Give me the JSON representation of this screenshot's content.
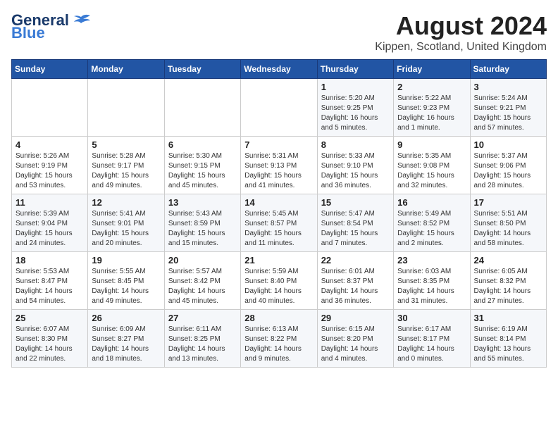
{
  "logo": {
    "general": "General",
    "blue": "Blue",
    "url_text": "GeneralBlue"
  },
  "title": "August 2024",
  "subtitle": "Kippen, Scotland, United Kingdom",
  "days_header": [
    "Sunday",
    "Monday",
    "Tuesday",
    "Wednesday",
    "Thursday",
    "Friday",
    "Saturday"
  ],
  "weeks": [
    [
      {
        "day": "",
        "content": ""
      },
      {
        "day": "",
        "content": ""
      },
      {
        "day": "",
        "content": ""
      },
      {
        "day": "",
        "content": ""
      },
      {
        "day": "1",
        "content": "Sunrise: 5:20 AM\nSunset: 9:25 PM\nDaylight: 16 hours\nand 5 minutes."
      },
      {
        "day": "2",
        "content": "Sunrise: 5:22 AM\nSunset: 9:23 PM\nDaylight: 16 hours\nand 1 minute."
      },
      {
        "day": "3",
        "content": "Sunrise: 5:24 AM\nSunset: 9:21 PM\nDaylight: 15 hours\nand 57 minutes."
      }
    ],
    [
      {
        "day": "4",
        "content": "Sunrise: 5:26 AM\nSunset: 9:19 PM\nDaylight: 15 hours\nand 53 minutes."
      },
      {
        "day": "5",
        "content": "Sunrise: 5:28 AM\nSunset: 9:17 PM\nDaylight: 15 hours\nand 49 minutes."
      },
      {
        "day": "6",
        "content": "Sunrise: 5:30 AM\nSunset: 9:15 PM\nDaylight: 15 hours\nand 45 minutes."
      },
      {
        "day": "7",
        "content": "Sunrise: 5:31 AM\nSunset: 9:13 PM\nDaylight: 15 hours\nand 41 minutes."
      },
      {
        "day": "8",
        "content": "Sunrise: 5:33 AM\nSunset: 9:10 PM\nDaylight: 15 hours\nand 36 minutes."
      },
      {
        "day": "9",
        "content": "Sunrise: 5:35 AM\nSunset: 9:08 PM\nDaylight: 15 hours\nand 32 minutes."
      },
      {
        "day": "10",
        "content": "Sunrise: 5:37 AM\nSunset: 9:06 PM\nDaylight: 15 hours\nand 28 minutes."
      }
    ],
    [
      {
        "day": "11",
        "content": "Sunrise: 5:39 AM\nSunset: 9:04 PM\nDaylight: 15 hours\nand 24 minutes."
      },
      {
        "day": "12",
        "content": "Sunrise: 5:41 AM\nSunset: 9:01 PM\nDaylight: 15 hours\nand 20 minutes."
      },
      {
        "day": "13",
        "content": "Sunrise: 5:43 AM\nSunset: 8:59 PM\nDaylight: 15 hours\nand 15 minutes."
      },
      {
        "day": "14",
        "content": "Sunrise: 5:45 AM\nSunset: 8:57 PM\nDaylight: 15 hours\nand 11 minutes."
      },
      {
        "day": "15",
        "content": "Sunrise: 5:47 AM\nSunset: 8:54 PM\nDaylight: 15 hours\nand 7 minutes."
      },
      {
        "day": "16",
        "content": "Sunrise: 5:49 AM\nSunset: 8:52 PM\nDaylight: 15 hours\nand 2 minutes."
      },
      {
        "day": "17",
        "content": "Sunrise: 5:51 AM\nSunset: 8:50 PM\nDaylight: 14 hours\nand 58 minutes."
      }
    ],
    [
      {
        "day": "18",
        "content": "Sunrise: 5:53 AM\nSunset: 8:47 PM\nDaylight: 14 hours\nand 54 minutes."
      },
      {
        "day": "19",
        "content": "Sunrise: 5:55 AM\nSunset: 8:45 PM\nDaylight: 14 hours\nand 49 minutes."
      },
      {
        "day": "20",
        "content": "Sunrise: 5:57 AM\nSunset: 8:42 PM\nDaylight: 14 hours\nand 45 minutes."
      },
      {
        "day": "21",
        "content": "Sunrise: 5:59 AM\nSunset: 8:40 PM\nDaylight: 14 hours\nand 40 minutes."
      },
      {
        "day": "22",
        "content": "Sunrise: 6:01 AM\nSunset: 8:37 PM\nDaylight: 14 hours\nand 36 minutes."
      },
      {
        "day": "23",
        "content": "Sunrise: 6:03 AM\nSunset: 8:35 PM\nDaylight: 14 hours\nand 31 minutes."
      },
      {
        "day": "24",
        "content": "Sunrise: 6:05 AM\nSunset: 8:32 PM\nDaylight: 14 hours\nand 27 minutes."
      }
    ],
    [
      {
        "day": "25",
        "content": "Sunrise: 6:07 AM\nSunset: 8:30 PM\nDaylight: 14 hours\nand 22 minutes."
      },
      {
        "day": "26",
        "content": "Sunrise: 6:09 AM\nSunset: 8:27 PM\nDaylight: 14 hours\nand 18 minutes."
      },
      {
        "day": "27",
        "content": "Sunrise: 6:11 AM\nSunset: 8:25 PM\nDaylight: 14 hours\nand 13 minutes."
      },
      {
        "day": "28",
        "content": "Sunrise: 6:13 AM\nSunset: 8:22 PM\nDaylight: 14 hours\nand 9 minutes."
      },
      {
        "day": "29",
        "content": "Sunrise: 6:15 AM\nSunset: 8:20 PM\nDaylight: 14 hours\nand 4 minutes."
      },
      {
        "day": "30",
        "content": "Sunrise: 6:17 AM\nSunset: 8:17 PM\nDaylight: 14 hours\nand 0 minutes."
      },
      {
        "day": "31",
        "content": "Sunrise: 6:19 AM\nSunset: 8:14 PM\nDaylight: 13 hours\nand 55 minutes."
      }
    ]
  ]
}
